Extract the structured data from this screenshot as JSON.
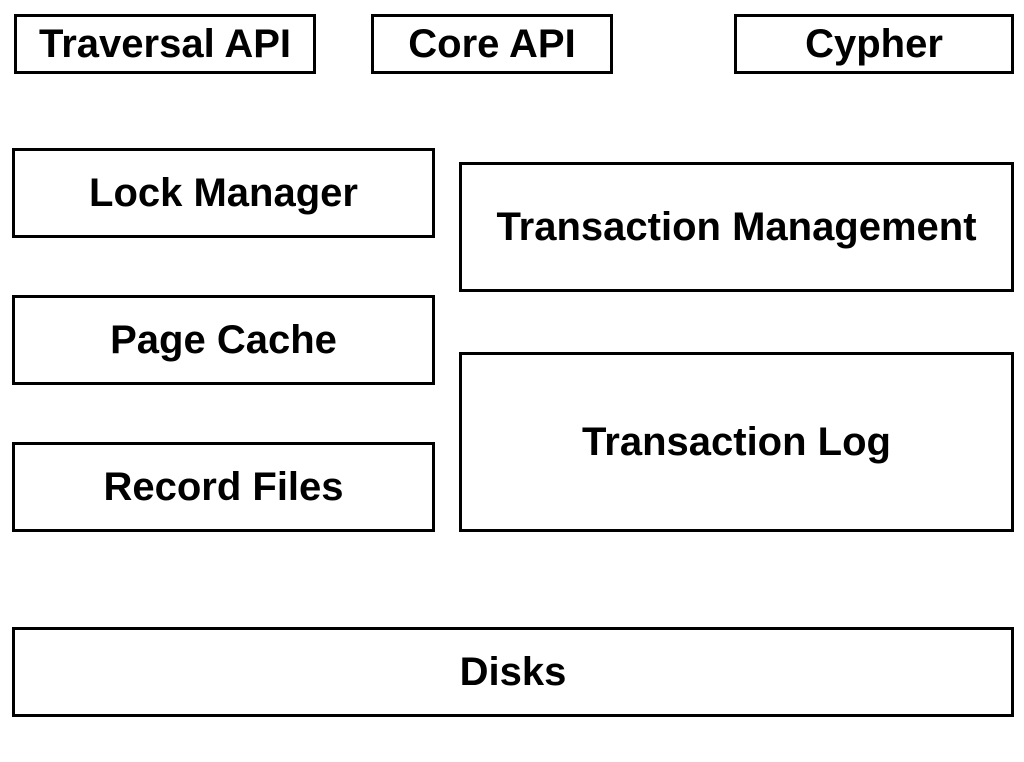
{
  "api_row": {
    "traversal": "Traversal API",
    "core": "Core API",
    "cypher": "Cypher"
  },
  "left_column": {
    "lock_manager": "Lock Manager",
    "page_cache": "Page Cache",
    "record_files": "Record Files"
  },
  "right_column": {
    "transaction_management": "Transaction Management",
    "transaction_log": "Transaction Log"
  },
  "bottom": {
    "disks": "Disks"
  }
}
